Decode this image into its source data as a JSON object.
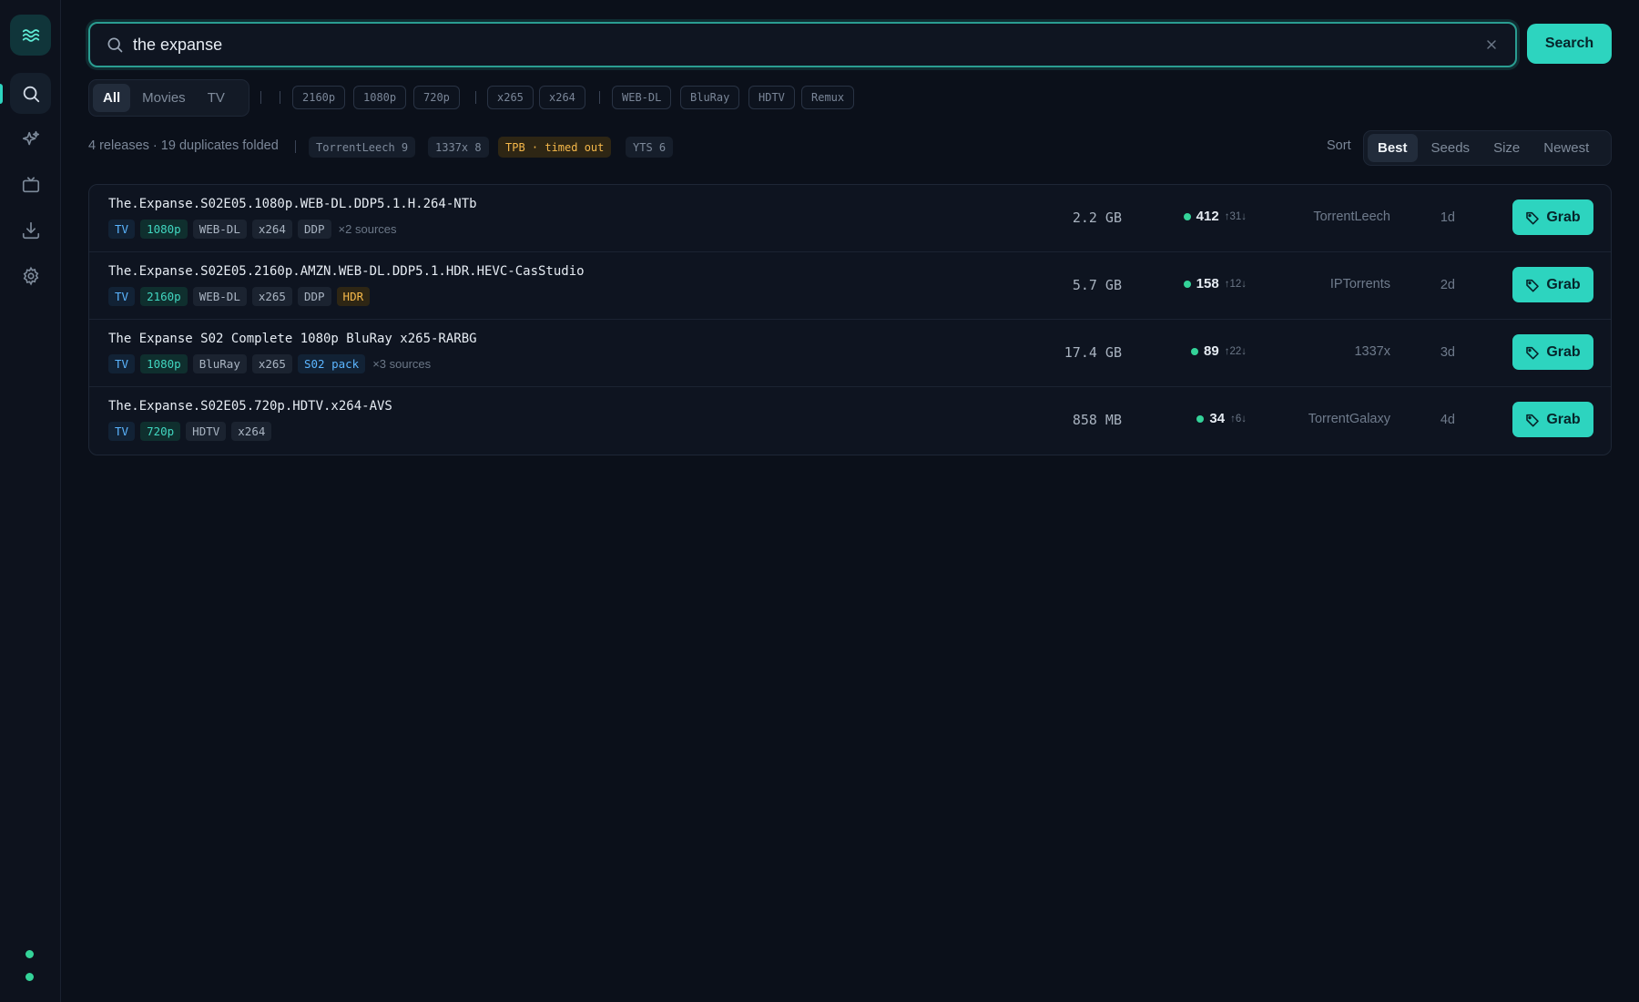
{
  "search": {
    "query": "the expanse",
    "button_label": "Search"
  },
  "type_filter": [
    "All",
    "Movies",
    "TV"
  ],
  "resolution_chips": [
    "2160p",
    "1080p",
    "720p"
  ],
  "codec_chips": [
    "x265",
    "x264"
  ],
  "source_chips": [
    "WEB-DL",
    "BluRay",
    "HDTV",
    "Remux"
  ],
  "summary": {
    "text": "4 releases · 19 duplicates folded",
    "sources": [
      {
        "label": "TorrentLeech 9",
        "status": "ok"
      },
      {
        "label": "1337x 8",
        "status": "ok"
      },
      {
        "label": "TPB · timed out",
        "status": "warn"
      },
      {
        "label": "YTS 6",
        "status": "ok"
      }
    ]
  },
  "sort": {
    "label": "Sort",
    "options": [
      "Best",
      "Seeds",
      "Size",
      "Newest"
    ],
    "selected": "Best"
  },
  "results": [
    {
      "name": "The.Expanse.S02E05.1080p.WEB-DL.DDP5.1.H.264-NTb",
      "tags": [
        {
          "t": "TV",
          "k": "tv"
        },
        {
          "t": "1080p",
          "k": "res"
        },
        {
          "t": "WEB-DL",
          "k": "plain"
        },
        {
          "t": "x264",
          "k": "plain"
        },
        {
          "t": "DDP",
          "k": "plain"
        }
      ],
      "extra": "×2 sources",
      "size": "2.2 GB",
      "seeds": "412",
      "peers": "↑31↓",
      "indexer": "TorrentLeech",
      "age": "1d",
      "grab_label": "Grab"
    },
    {
      "name": "The.Expanse.S02E05.2160p.AMZN.WEB-DL.DDP5.1.HDR.HEVC-CasStudio",
      "tags": [
        {
          "t": "TV",
          "k": "tv"
        },
        {
          "t": "2160p",
          "k": "res"
        },
        {
          "t": "WEB-DL",
          "k": "plain"
        },
        {
          "t": "x265",
          "k": "plain"
        },
        {
          "t": "DDP",
          "k": "plain"
        },
        {
          "t": "HDR",
          "k": "hdr"
        }
      ],
      "extra": "",
      "size": "5.7 GB",
      "seeds": "158",
      "peers": "↑12↓",
      "indexer": "IPTorrents",
      "age": "2d",
      "grab_label": "Grab"
    },
    {
      "name": "The Expanse S02 Complete 1080p BluRay x265-RARBG",
      "tags": [
        {
          "t": "TV",
          "k": "tv"
        },
        {
          "t": "1080p",
          "k": "res"
        },
        {
          "t": "BluRay",
          "k": "plain"
        },
        {
          "t": "x265",
          "k": "plain"
        },
        {
          "t": "S02 pack",
          "k": "pack"
        }
      ],
      "extra": "×3 sources",
      "size": "17.4 GB",
      "seeds": "89",
      "peers": "↑22↓",
      "indexer": "1337x",
      "age": "3d",
      "grab_label": "Grab"
    },
    {
      "name": "The.Expanse.S02E05.720p.HDTV.x264-AVS",
      "tags": [
        {
          "t": "TV",
          "k": "tv"
        },
        {
          "t": "720p",
          "k": "res"
        },
        {
          "t": "HDTV",
          "k": "plain"
        },
        {
          "t": "x264",
          "k": "plain"
        }
      ],
      "extra": "",
      "size": "858 MB",
      "seeds": "34",
      "peers": "↑6↓",
      "indexer": "TorrentGalaxy",
      "age": "4d",
      "grab_label": "Grab"
    }
  ],
  "colors": {
    "accent": "#2dd4bf",
    "warn": "#f5b84a",
    "seed": "#34d399",
    "background": "#0b101a"
  },
  "sidebar": {
    "items": [
      "search-icon",
      "sparkle-icon",
      "tv-icon",
      "download-icon",
      "gear-icon"
    ]
  }
}
